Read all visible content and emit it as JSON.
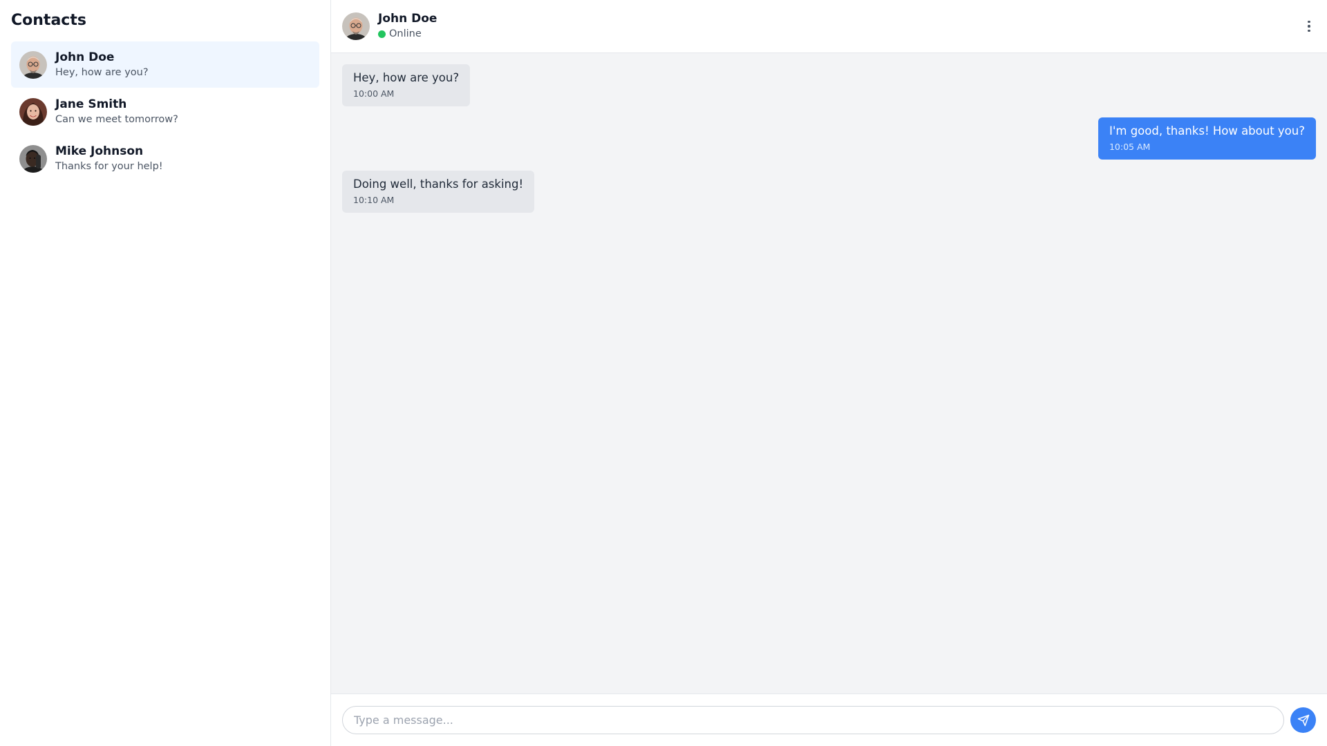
{
  "sidebar": {
    "title": "Contacts",
    "contacts": [
      {
        "name": "John Doe",
        "preview": "Hey, how are you?",
        "active": true
      },
      {
        "name": "Jane Smith",
        "preview": "Can we meet tomorrow?",
        "active": false
      },
      {
        "name": "Mike Johnson",
        "preview": "Thanks for your help!",
        "active": false
      }
    ]
  },
  "header": {
    "name": "John Doe",
    "status": "Online",
    "status_color": "#22c55e"
  },
  "messages": [
    {
      "text": "Hey, how are you?",
      "time": "10:00 AM",
      "direction": "in"
    },
    {
      "text": "I'm good, thanks! How about you?",
      "time": "10:05 AM",
      "direction": "out"
    },
    {
      "text": "Doing well, thanks for asking!",
      "time": "10:10 AM",
      "direction": "in"
    }
  ],
  "composer": {
    "placeholder": "Type a message...",
    "value": ""
  },
  "icons": {
    "menu": "more-vertical-icon",
    "send": "send-icon"
  },
  "colors": {
    "accent": "#3b82f6",
    "active_contact_bg": "#eff6ff",
    "incoming_bubble": "#e5e7eb",
    "chat_bg": "#f3f4f6"
  }
}
